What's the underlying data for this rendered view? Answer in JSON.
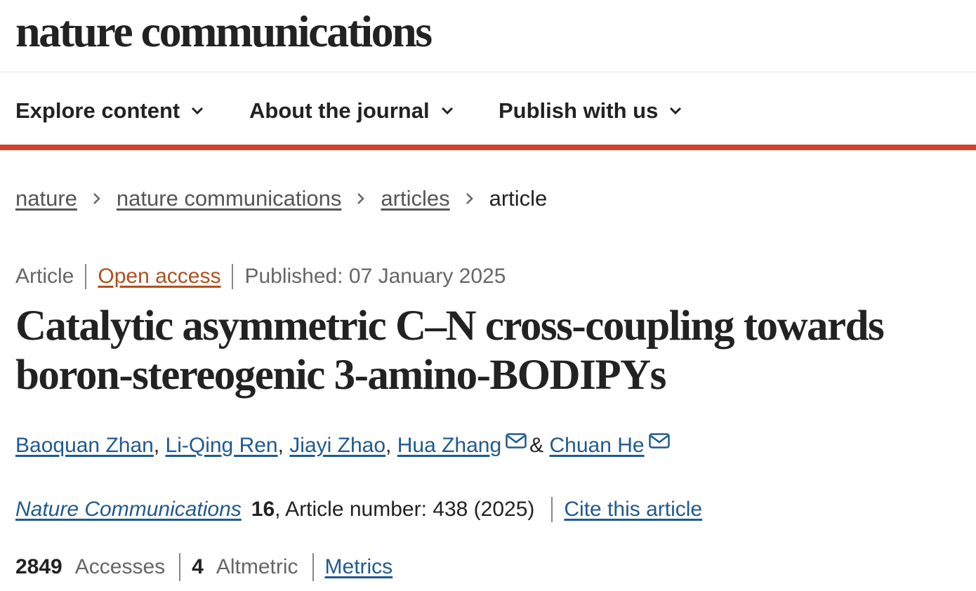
{
  "site": {
    "logo": "nature communications"
  },
  "nav": {
    "items": [
      {
        "label": "Explore content",
        "icon": "chevron-down-icon"
      },
      {
        "label": "About the journal",
        "icon": "chevron-down-icon"
      },
      {
        "label": "Publish with us",
        "icon": "chevron-down-icon"
      }
    ]
  },
  "colors": {
    "accent": "#d3412f",
    "link": "#1f5a8f",
    "open_access": "#b24f1d"
  },
  "breadcrumb": {
    "items": [
      "nature",
      "nature communications",
      "articles"
    ],
    "current": "article"
  },
  "article": {
    "type": "Article",
    "access": "Open access",
    "published": "Published: 07 January 2025",
    "title": "Catalytic asymmetric C–N cross-coupling towards boron-stereogenic 3-amino-BODIPYs",
    "authors": [
      {
        "name": "Baoquan Zhan",
        "sep": ",",
        "email": false
      },
      {
        "name": "Li-Qing Ren",
        "sep": ",",
        "email": false
      },
      {
        "name": "Jiayi Zhao",
        "sep": ",",
        "email": false
      },
      {
        "name": "Hua Zhang",
        "sep": "&",
        "email": true
      },
      {
        "name": "Chuan He",
        "sep": "",
        "email": true
      }
    ],
    "citation": {
      "journal": "Nature Communications",
      "volume": "16",
      "rest": ", Article number: 438 (2025)",
      "cite_label": "Cite this article"
    },
    "metrics": {
      "accesses_count": "2849",
      "accesses_label": "Accesses",
      "altmetric_count": "4",
      "altmetric_label": "Altmetric",
      "metrics_link": "Metrics"
    }
  }
}
